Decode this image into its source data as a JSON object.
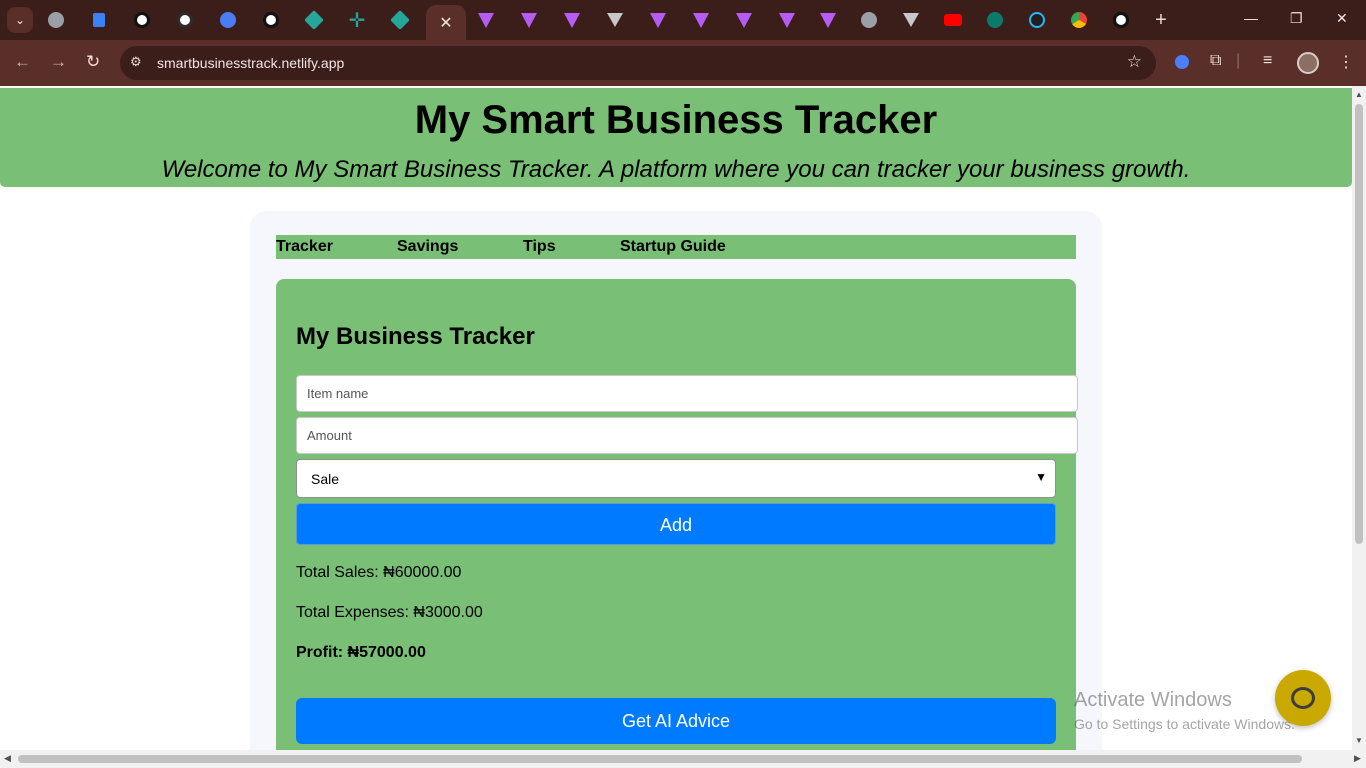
{
  "browser": {
    "url": "smartbusinesstrack.netlify.app",
    "tab_icons": [
      "globe-icon",
      "vercel-icon",
      "github-icon",
      "openai-icon",
      "react-icon",
      "github-icon",
      "diamond-icon",
      "plus-cross-icon",
      "diamond-icon",
      "close-icon",
      "vite-icon",
      "vite-icon",
      "vite-icon",
      "triangle-icon",
      "vite-icon",
      "vite-icon",
      "vite-icon",
      "vite-icon",
      "vite-icon",
      "globe-icon",
      "triangle-icon",
      "youtube-icon",
      "mongodb-icon",
      "react-icon",
      "chrome-icon",
      "github-icon"
    ]
  },
  "header": {
    "title": "My Smart Business Tracker",
    "subtitle": "Welcome to My Smart Business Tracker. A platform where you can tracker your business growth."
  },
  "menu": {
    "items": [
      "Tracker",
      "Savings",
      "Tips",
      "Startup Guide"
    ]
  },
  "tracker": {
    "heading": "My Business Tracker",
    "item_placeholder": "Item name",
    "amount_placeholder": "Amount",
    "type_selected": "Sale",
    "add_label": "Add",
    "total_sales": "Total Sales: ₦60000.00",
    "total_expenses": "Total Expenses: ₦3000.00",
    "profit": "Profit: ₦57000.00",
    "ai_label": "Get AI Advice"
  },
  "overlay": {
    "activate_title": "Activate Windows",
    "activate_sub": "Go to Settings to activate Windows."
  },
  "colors": {
    "accent_green": "#79bf76",
    "button_blue": "#007bff",
    "chrome_dark": "#3b1d19"
  }
}
